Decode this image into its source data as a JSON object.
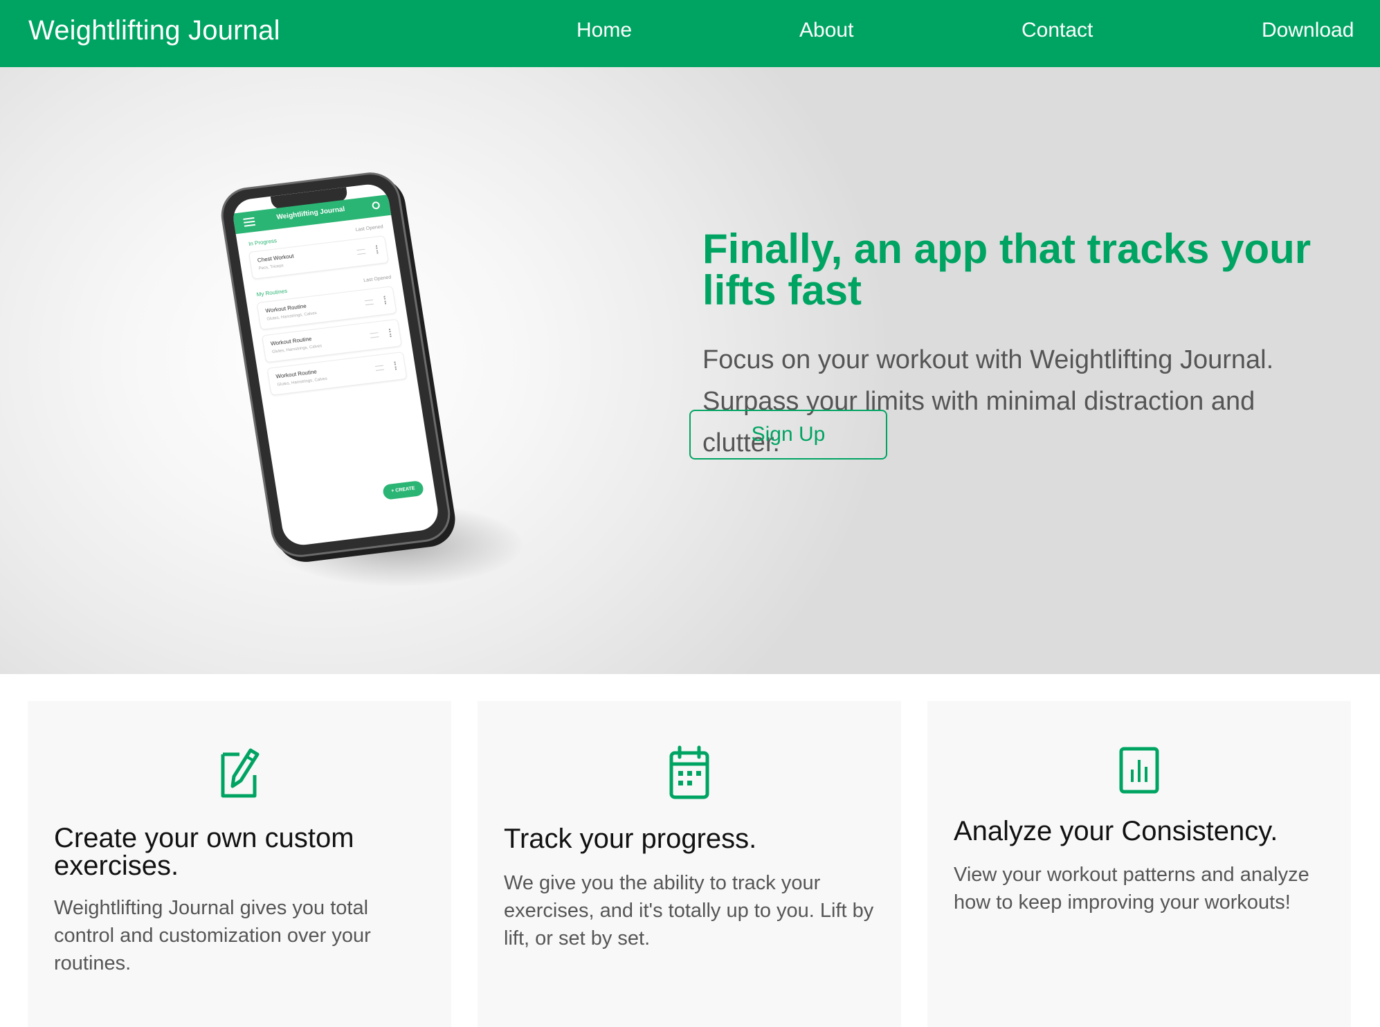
{
  "colors": {
    "brand_green": "#00a462",
    "nav_text": "#ffffff",
    "heading_dark": "#111111",
    "body_gray": "#555555",
    "card_bg": "#f8f8f8"
  },
  "navbar": {
    "brand": "Weightlifting Journal",
    "links": [
      "Home",
      "About",
      "Contact",
      "Download"
    ]
  },
  "hero": {
    "title": "Finally, an app that tracks your lifts fast",
    "subtitle": "Focus on your workout with Weightlifting Journal. Surpass your limits with minimal distraction and clutter.",
    "cta_label": "Sign Up",
    "phone_mockup": {
      "app_title": "Weightlifting Journal",
      "in_progress_label": "In Progress",
      "in_progress_sort": "Last Opened",
      "in_progress_item": {
        "title": "Chest Workout",
        "subtitle": "Pecs, Triceps"
      },
      "routines_label": "My Routines",
      "routines_sort": "Last Opened",
      "routines": [
        {
          "title": "Workout Routine",
          "subtitle": "Glutes, Hamstrings, Calves"
        },
        {
          "title": "Workout Routine",
          "subtitle": "Glutes, Hamstrings, Calves"
        },
        {
          "title": "Workout Routine",
          "subtitle": "Glutes, Hamstrings, Calves"
        }
      ],
      "fab_label": "+ CREATE"
    }
  },
  "features": [
    {
      "icon": "edit-icon",
      "title": "Create your own custom exercises.",
      "description": "Weightlifting Journal gives you total control and customization over your routines."
    },
    {
      "icon": "calendar-icon",
      "title": "Track your progress.",
      "description": "We give you the ability to track your exercises, and it's totally up to you. Lift by lift, or set by set."
    },
    {
      "icon": "bar-chart-icon",
      "title": "Analyze your Consistency.",
      "description": "View your workout patterns and analyze how to keep improving your workouts!"
    }
  ]
}
